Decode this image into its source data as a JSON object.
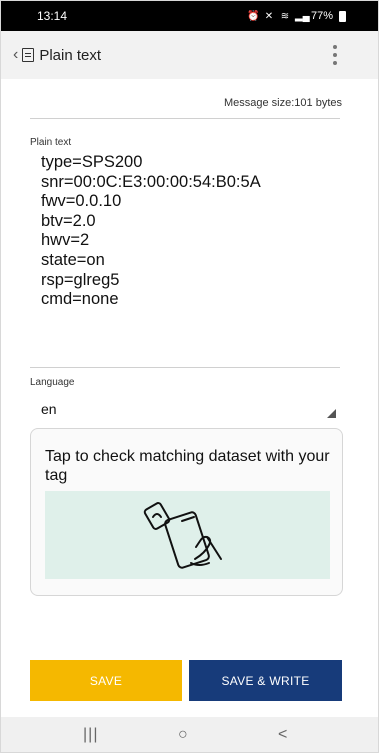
{
  "status": {
    "time": "13:14",
    "battery": "77%"
  },
  "header": {
    "title": "Plain text"
  },
  "message_size": "Message size:101 bytes",
  "plain_text": {
    "label": "Plain text",
    "lines": [
      "type=SPS200",
      "snr=00:0C:E3:00:00:54:B0:5A",
      "fwv=0.0.10",
      "btv=2.0",
      "hwv=2",
      "state=on",
      "rsp=glreg5",
      "cmd=none"
    ]
  },
  "language": {
    "label": "Language",
    "value": "en"
  },
  "card": {
    "text": "Tap to check matching dataset with your tag"
  },
  "buttons": {
    "save": "SAVE",
    "save_write": "SAVE & WRITE"
  },
  "nav": {
    "recents": "|||",
    "home": "○",
    "back": "<"
  },
  "colors": {
    "save": "#F5B800",
    "save_write": "#173B7A",
    "illustration_bg": "#DFF0EA"
  }
}
